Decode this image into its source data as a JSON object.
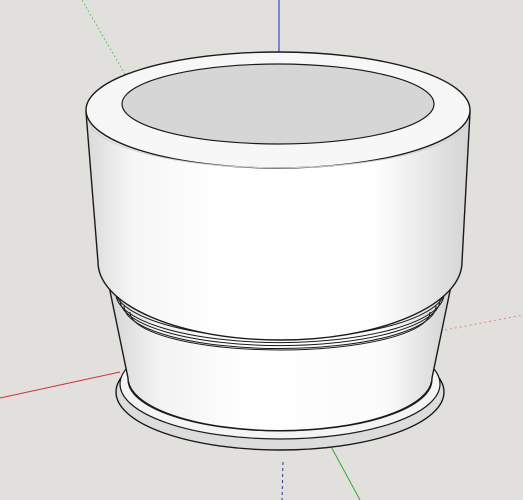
{
  "app": {
    "view": "3d-model-viewport"
  },
  "scene": {
    "background": "#e1e0dd",
    "model": "cylindrical-jar-with-lid",
    "colors": {
      "face": "#ffffff",
      "shade": "#d6d6d6",
      "top_face": "#d8d8d8",
      "edge": "#1a1a1a"
    },
    "axes": [
      {
        "name": "red-axis",
        "color": "#cc3333"
      },
      {
        "name": "green-axis",
        "color": "#33aa33"
      },
      {
        "name": "blue-axis",
        "color": "#2222cc"
      }
    ]
  }
}
